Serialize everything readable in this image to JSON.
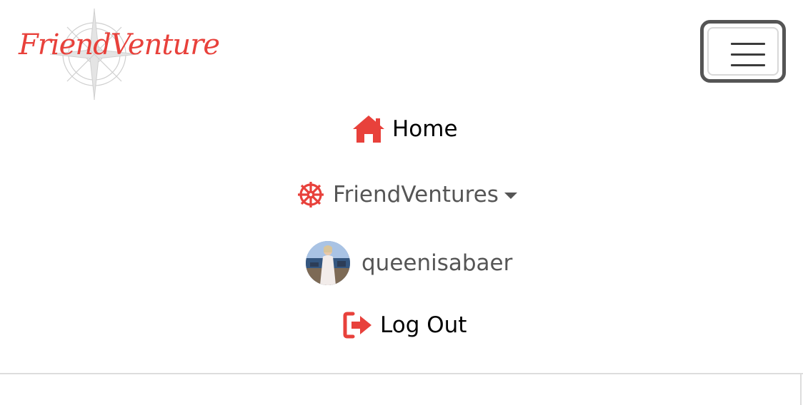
{
  "brand": {
    "name": "FriendVenture",
    "accent_color": "#e8413b",
    "logo_icon": "compass-rose-icon"
  },
  "navbar_toggler": {
    "icon": "hamburger-menu-icon"
  },
  "nav": {
    "items": [
      {
        "label": "Home",
        "icon": "house-icon"
      },
      {
        "label": "FriendVentures",
        "icon": "dharma-wheel-icon",
        "has_dropdown": true
      },
      {
        "label": "queenisabaer",
        "icon": "user-avatar"
      },
      {
        "label": "Log Out",
        "icon": "sign-out-icon"
      }
    ]
  }
}
